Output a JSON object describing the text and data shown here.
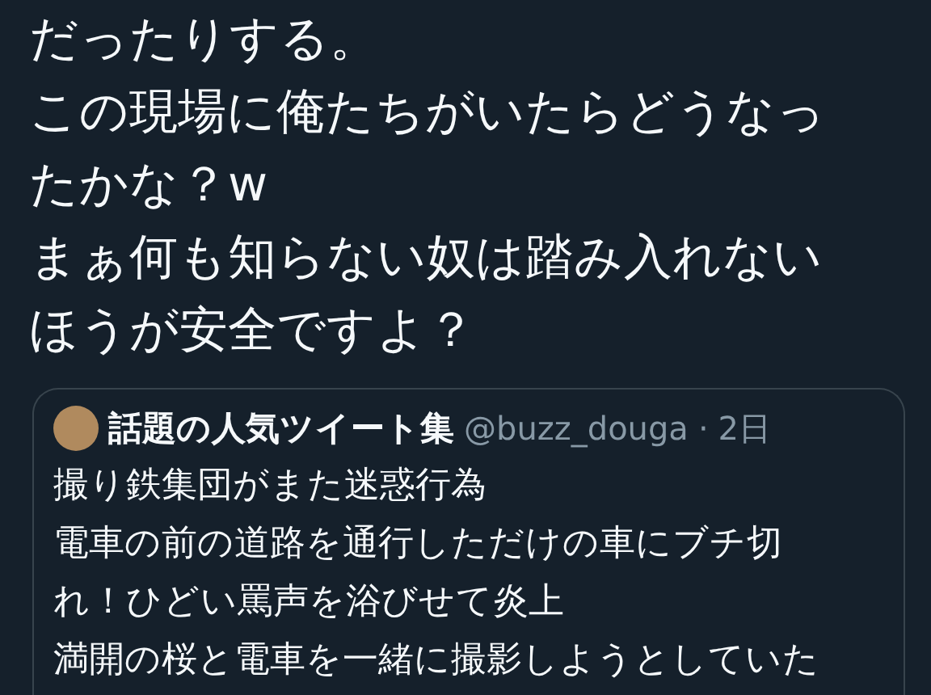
{
  "tweet": {
    "lines": [
      "だったりする。",
      "この現場に俺たちがいたらどうなっ",
      "たかな？w",
      "まぁ何も知らない奴は踏み入れない",
      "ほうが安全ですよ？"
    ]
  },
  "quoted_tweet": {
    "display_name": "話題の人気ツイート集",
    "handle": "@buzz_douga",
    "separator": "·",
    "time": "2日",
    "lines": [
      "撮り鉄集団がまた迷惑行為",
      "電車の前の道路を通行しただけの車にブチ切",
      "れ！ひどい罵声を浴びせて炎上",
      "満開の桜と電車を一緒に撮影しようとしていた"
    ]
  }
}
